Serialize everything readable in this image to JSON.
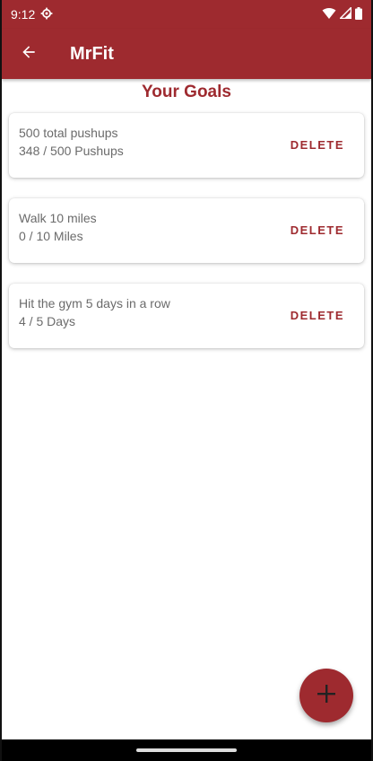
{
  "status_bar": {
    "time": "9:12"
  },
  "app_bar": {
    "title": "MrFit"
  },
  "page": {
    "title": "Your Goals"
  },
  "goals": [
    {
      "title": "500 total pushups",
      "progress": "348 / 500 Pushups",
      "delete_label": "DELETE"
    },
    {
      "title": "Walk 10 miles",
      "progress": "0 / 10 Miles",
      "delete_label": "DELETE"
    },
    {
      "title": "Hit the gym 5 days in a row",
      "progress": "4 / 5 Days",
      "delete_label": "DELETE"
    }
  ],
  "colors": {
    "primary": "#9e2a2f",
    "text_secondary": "#6b6b6b"
  },
  "icons": {
    "back": "arrow-back-icon",
    "add": "plus-icon"
  }
}
